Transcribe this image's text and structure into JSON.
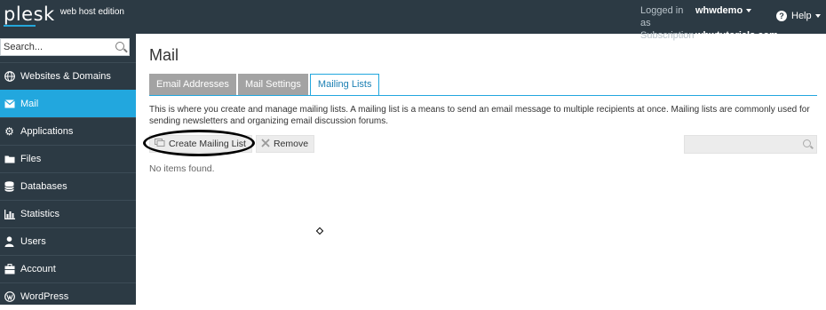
{
  "header": {
    "logo_word": "plesk",
    "edition": "web host edition",
    "logged_in_label": "Logged in as",
    "user": "whwdemo",
    "subscription_label": "Subscription",
    "subscription": "whwtutorials.com",
    "help_label": "Help"
  },
  "sidebar": {
    "search_placeholder": "Search...",
    "items": [
      {
        "label": "Websites & Domains",
        "icon": "globe-icon"
      },
      {
        "label": "Mail",
        "icon": "mail-icon",
        "active": true
      },
      {
        "label": "Applications",
        "icon": "gear-icon"
      },
      {
        "label": "Files",
        "icon": "folder-icon"
      },
      {
        "label": "Databases",
        "icon": "database-icon"
      },
      {
        "label": "Statistics",
        "icon": "bar-chart-icon"
      },
      {
        "label": "Users",
        "icon": "user-icon"
      },
      {
        "label": "Account",
        "icon": "account-icon"
      },
      {
        "label": "WordPress",
        "icon": "wordpress-icon"
      }
    ]
  },
  "main": {
    "title": "Mail",
    "tabs": [
      {
        "label": "Email Addresses"
      },
      {
        "label": "Mail Settings"
      },
      {
        "label": "Mailing Lists",
        "active": true
      }
    ],
    "description": "This is where you create and manage mailing lists. A mailing list is a means to send an email message to multiple recipients at once. Mailing lists are commonly used for sending newsletters and organizing email discussion forums.",
    "create_button": "Create Mailing List",
    "remove_button": "Remove",
    "empty_text": "No items found."
  },
  "colors": {
    "topbar": "#2c3a44",
    "accent": "#22a7de",
    "inactive_tab": "#a3a3a3"
  }
}
